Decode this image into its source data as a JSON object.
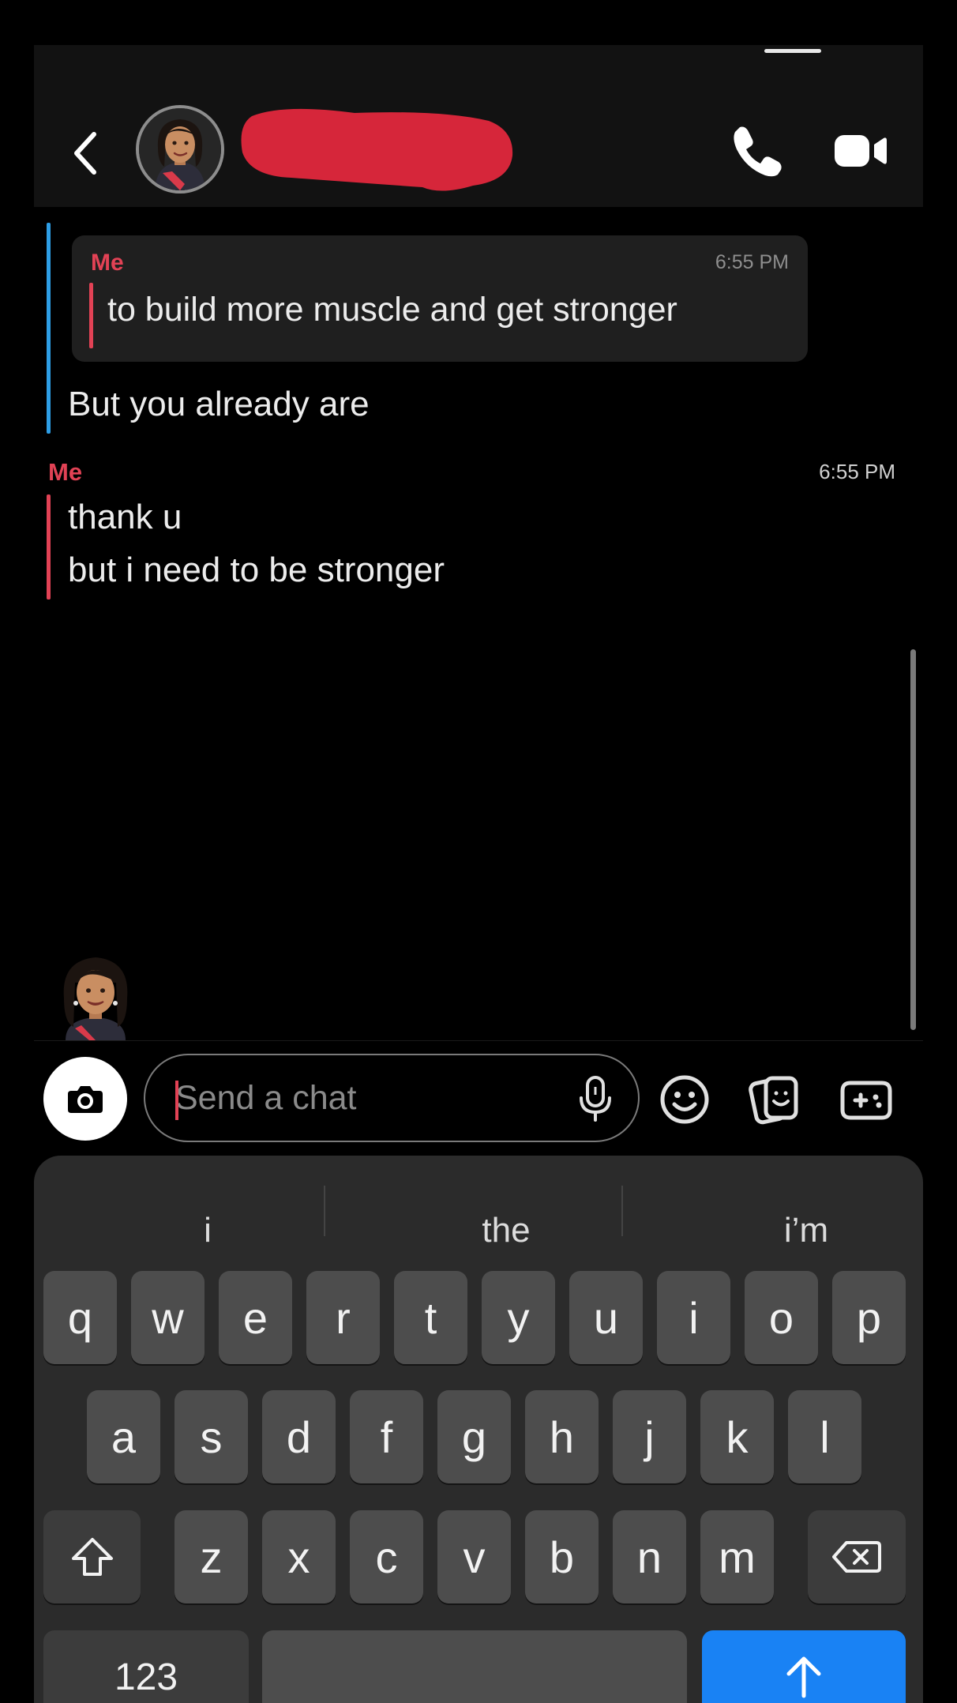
{
  "header": {
    "back_icon": "chevron-left-icon",
    "avatar_icon": "bitmoji-avatar",
    "contact_name_redacted": true,
    "call_icon": "phone-icon",
    "video_icon": "video-camera-icon"
  },
  "chat": {
    "quoted_reply": {
      "sender": "Me",
      "time": "6:55 PM",
      "text": "to build more muscle and get stronger"
    },
    "other_message": {
      "text": "But you already are"
    },
    "my_message": {
      "sender": "Me",
      "time": "6:55 PM",
      "lines": [
        "thank u",
        "but i need to be stronger"
      ]
    }
  },
  "composer": {
    "placeholder": "Send a chat",
    "camera_icon": "camera-icon",
    "mic_icon": "microphone-icon",
    "emoji_icon": "smiley-icon",
    "sticker_icon": "sticker-icon",
    "game_icon": "gamepad-icon"
  },
  "keyboard": {
    "suggestions": [
      "i",
      "the",
      "i’m"
    ],
    "row1": [
      "q",
      "w",
      "e",
      "r",
      "t",
      "y",
      "u",
      "i",
      "o",
      "p"
    ],
    "row2": [
      "a",
      "s",
      "d",
      "f",
      "g",
      "h",
      "j",
      "k",
      "l"
    ],
    "row3": [
      "z",
      "x",
      "c",
      "v",
      "b",
      "n",
      "m"
    ],
    "numbers_label": "123",
    "send_symbol": "↑"
  },
  "colors": {
    "me_accent": "#e24255",
    "other_accent": "#2e9ee6",
    "send_key": "#1982f4"
  }
}
